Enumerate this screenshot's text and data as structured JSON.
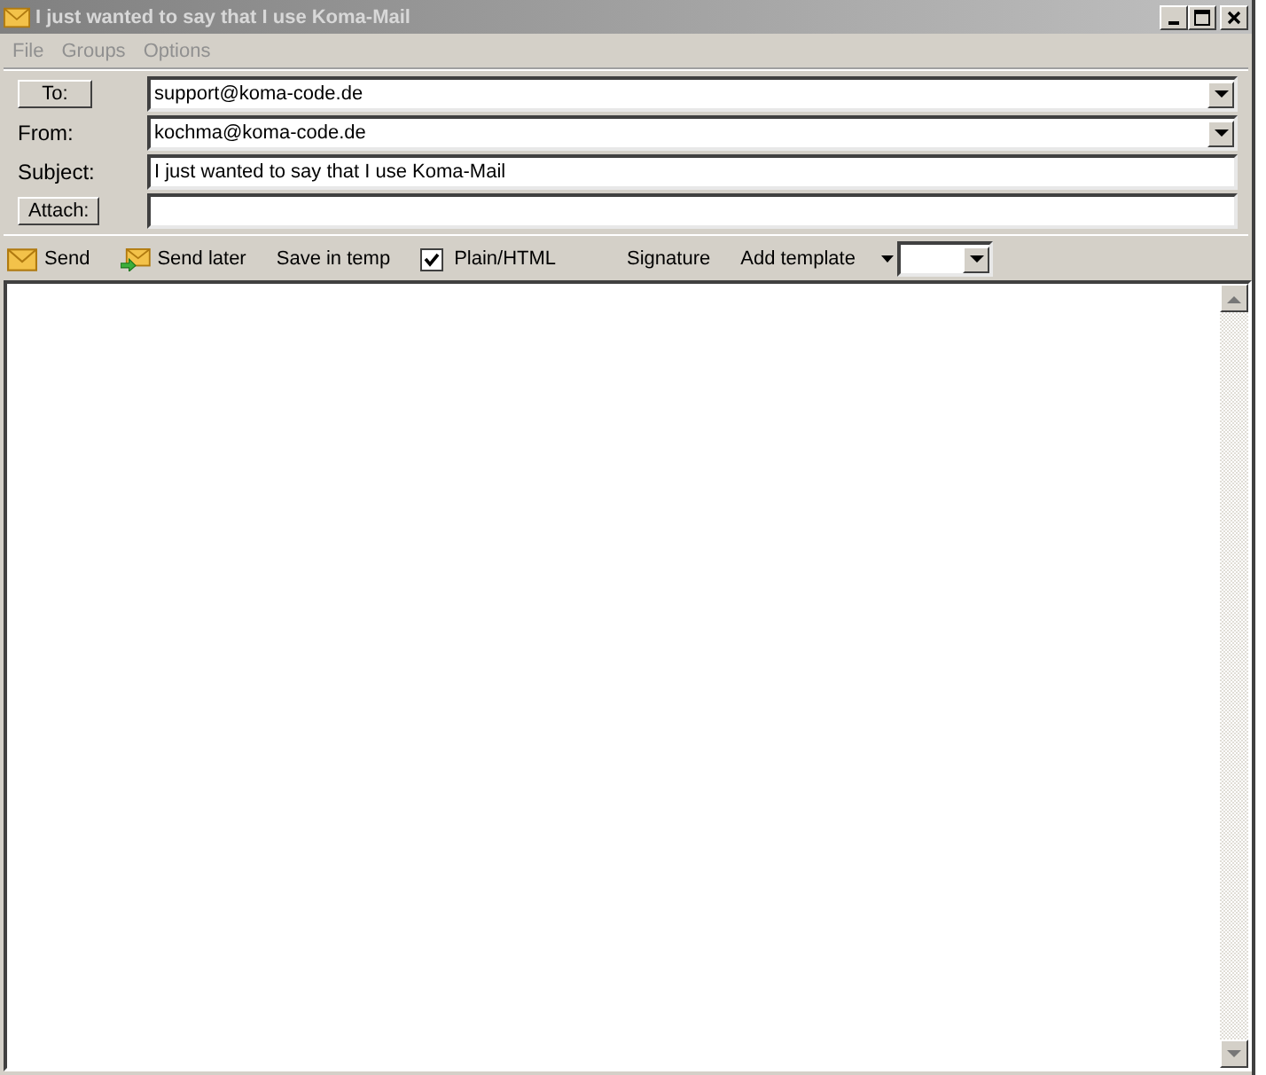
{
  "window": {
    "title": "I just wanted to say that I use Koma-Mail"
  },
  "menu": [
    "File",
    "Groups",
    "Options"
  ],
  "fields": [
    {
      "label": "To:",
      "label_button": true,
      "kind": "combo",
      "value": "support@koma-code.de"
    },
    {
      "label": "From:",
      "label_button": false,
      "kind": "combo",
      "value": "kochma@koma-code.de"
    },
    {
      "label": "Subject:",
      "label_button": false,
      "kind": "text",
      "value": "I just wanted to say that I use Koma-Mail"
    },
    {
      "label": "Attach:",
      "label_button": true,
      "kind": "text"
    }
  ],
  "toolbar": [
    {
      "kind": "icon-button",
      "label": "Send"
    },
    {
      "kind": "icon-button",
      "label": "Send later"
    },
    {
      "kind": "button",
      "label": "Save in temp"
    },
    {
      "kind": "checkbox",
      "label": "Plain/HTML",
      "checked": true
    },
    {
      "kind": "button",
      "label": "Signature"
    },
    {
      "kind": "menu-button",
      "label": "Add template"
    },
    {
      "kind": "combo"
    }
  ]
}
